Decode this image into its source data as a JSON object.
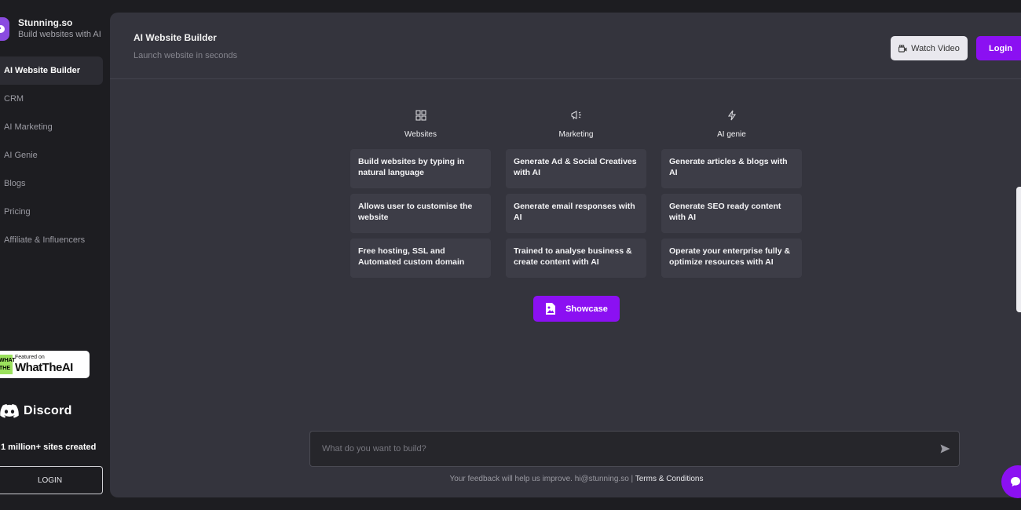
{
  "brand": {
    "name": "Stunning.so",
    "tagline": "Build websites with AI"
  },
  "sidebar": {
    "items": [
      {
        "label": "AI Website Builder",
        "active": true
      },
      {
        "label": "CRM",
        "active": false
      },
      {
        "label": "AI Marketing",
        "active": false
      },
      {
        "label": "AI Genie",
        "active": false
      },
      {
        "label": "Blogs",
        "active": false
      },
      {
        "label": "Pricing",
        "active": false
      },
      {
        "label": "Affiliate & Influencers",
        "active": false
      }
    ],
    "badge": {
      "mark": "WHAT THE",
      "small": "Featured on",
      "big": "WhatTheAI"
    },
    "discord_label": "Discord",
    "sites_created": "1 million+ sites created",
    "login_label": "LOGIN"
  },
  "header": {
    "title": "AI Website Builder",
    "subtitle": "Launch website in seconds",
    "watch_label": "Watch Video",
    "login_label": "Login"
  },
  "features": [
    {
      "title": "Websites",
      "icon": "grid-icon",
      "items": [
        "Build websites by typing in natural language",
        "Allows user to customise the website",
        "Free hosting, SSL and Automated custom domain"
      ]
    },
    {
      "title": "Marketing",
      "icon": "megaphone-icon",
      "items": [
        "Generate Ad & Social Creatives with AI",
        "Generate email responses with AI",
        "Trained to analyse business & create content with AI"
      ]
    },
    {
      "title": "AI genie",
      "icon": "lightning-icon",
      "items": [
        "Generate articles & blogs with AI",
        "Generate SEO ready content with AI",
        "Operate your enterprise fully & optimize resources with AI"
      ]
    }
  ],
  "showcase_label": "Showcase",
  "prompt": {
    "placeholder": "What do you want to build?"
  },
  "footer": {
    "feedback": "Your feedback will help us improve. hi@stunning.so | ",
    "terms": "Terms & Conditions"
  },
  "colors": {
    "accent": "#8b10f2",
    "panel": "#34343d",
    "card": "#3d3d47",
    "background": "#1d1d21"
  }
}
